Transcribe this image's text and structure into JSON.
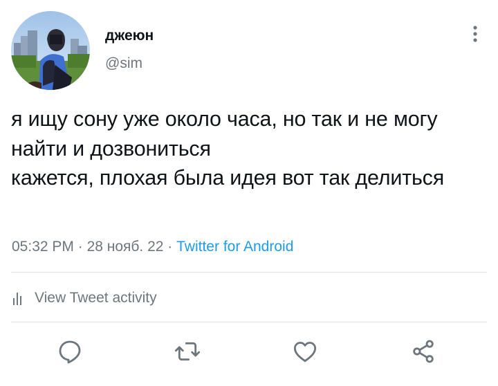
{
  "user": {
    "display_name": "джеюн",
    "handle": "@sim",
    "avatar_icon": "profile-photo"
  },
  "tweet": {
    "text": "я ищу сону уже около часа, но так и не могу найти и дозвониться\nкажется, плохая была идея вот так делиться",
    "time": "05:32 PM",
    "separator": " · ",
    "date": "28 нояб. 22",
    "source": "Twitter for Android"
  },
  "activity": {
    "label": "View Tweet activity",
    "icon": "analytics-bars-icon"
  },
  "actions": {
    "reply_icon": "reply-icon",
    "retweet_icon": "retweet-icon",
    "like_icon": "like-icon",
    "share_icon": "share-icon"
  },
  "colors": {
    "text": "#0f1419",
    "secondary": "#6e767d",
    "accent": "#1d9bf0",
    "divider": "#dfe3e6"
  }
}
